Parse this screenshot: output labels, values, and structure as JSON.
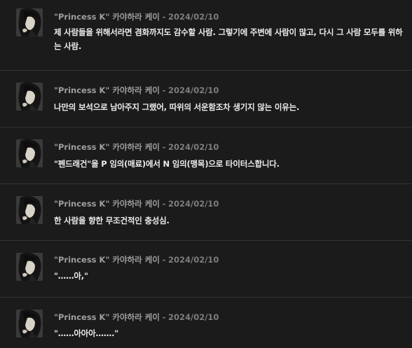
{
  "comments": [
    {
      "author": "\"Princess K\" 카야하라 케이",
      "separator": "-",
      "date": "2024/02/10",
      "text": "제 사람들을 위해서라면 겸화까지도 감수할 사람. 그렇기에 주변에 사람이 많고, 다시 그 사람 모두를 위하는 사람."
    },
    {
      "author": "\"Princess K\" 카야하라 케이",
      "separator": "-",
      "date": "2024/02/10",
      "text": "나만의 보석으로 남아주지 그랬어, 따위의 서운함조차 생기지 않는 이유는."
    },
    {
      "author": "\"Princess K\" 카야하라 케이",
      "separator": "-",
      "date": "2024/02/10",
      "text": "\"펜드래건\"을 P 임의(매료)에서 N 임의(맹목)으로 타이터스합니다."
    },
    {
      "author": "\"Princess K\" 카야하라 케이",
      "separator": "-",
      "date": "2024/02/10",
      "text": "한 사람을 향한 무조건적인 충성심."
    },
    {
      "author": "\"Princess K\" 카야하라 케이",
      "separator": "-",
      "date": "2024/02/10",
      "text": "\"……아,\""
    },
    {
      "author": "\"Princess K\" 카야하라 케이",
      "separator": "-",
      "date": "2024/02/10",
      "text": "\"……아아아…….\""
    }
  ]
}
